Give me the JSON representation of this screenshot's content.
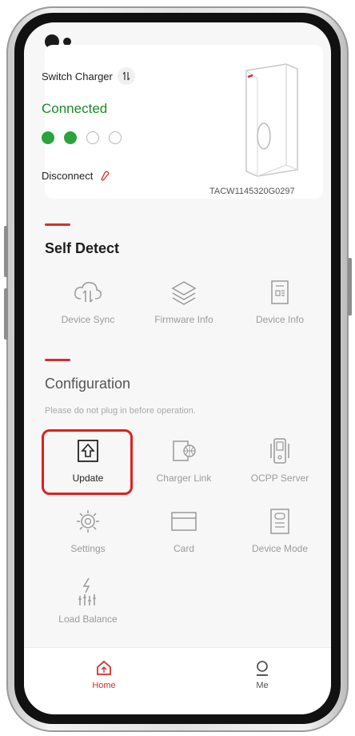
{
  "charger": {
    "switch_label": "Switch Charger",
    "status": "Connected",
    "disconnect_label": "Disconnect",
    "serial": "TACW1145320G0297",
    "status_icons": [
      "wifi-icon",
      "wifi-icon",
      "globe-icon",
      "link-icon"
    ]
  },
  "self_detect": {
    "title": "Self Detect",
    "items": [
      {
        "label": "Device Sync",
        "icon": "cloud-sync-icon"
      },
      {
        "label": "Firmware Info",
        "icon": "layers-icon"
      },
      {
        "label": "Device Info",
        "icon": "device-info-icon"
      }
    ]
  },
  "configuration": {
    "title": "Configuration",
    "hint": "Please do not plug in before operation.",
    "items": [
      {
        "label": "Update",
        "icon": "upload-icon"
      },
      {
        "label": "Charger Link",
        "icon": "charger-link-icon"
      },
      {
        "label": "OCPP Server",
        "icon": "server-icon"
      },
      {
        "label": "Settings",
        "icon": "gear-icon"
      },
      {
        "label": "Card",
        "icon": "card-icon"
      },
      {
        "label": "Device Mode",
        "icon": "device-mode-icon"
      },
      {
        "label": "Load Balance",
        "icon": "load-balance-icon"
      }
    ]
  },
  "nav": {
    "home": "Home",
    "me": "Me"
  },
  "colors": {
    "accent": "#d32f2f",
    "connected": "#1a8a22",
    "highlight": "#e0201e"
  }
}
